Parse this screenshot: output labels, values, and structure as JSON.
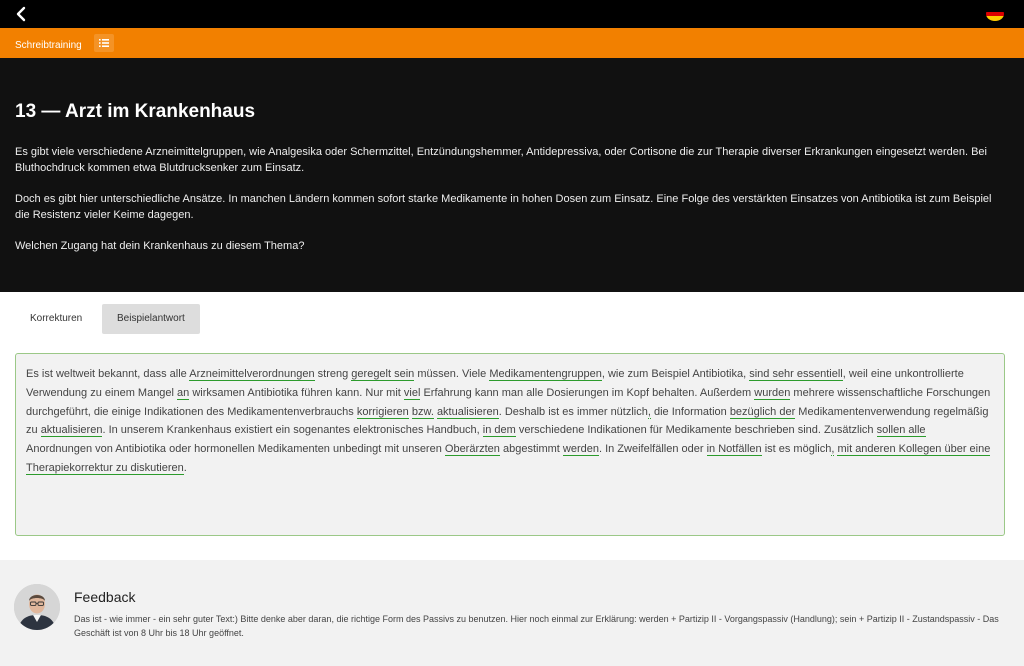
{
  "topbar": {
    "back_icon": "chevron-left-icon",
    "flag_icon": "german-flag-icon",
    "flag_colors": [
      "#000000",
      "#dd0000",
      "#ffcc00"
    ]
  },
  "header": {
    "section_title": "Schreibtraining",
    "list_icon": "list-icon"
  },
  "exercise": {
    "title": "13 — Arzt im Krankenhaus",
    "paragraphs": [
      "Es gibt viele verschiedene Arzneimittelgruppen, wie Analgesika oder Schermzittel, Entzündungshemmer, Antidepressiva, oder Cortisone die zur Therapie diverser Erkrankungen eingesetzt werden. Bei Bluthochdruck kommen etwa Blutdrucksenker zum Einsatz.",
      "Doch es gibt hier unterschiedliche Ansätze. In manchen Ländern kommen sofort starke Medikamente in hohen Dosen zum Einsatz. Eine Folge des verstärkten Einsatzes von Antibiotika ist zum Beispiel die Resistenz vieler Keime dagegen.",
      "Welchen Zugang hat dein Krankenhaus zu diesem Thema?"
    ]
  },
  "tabs": [
    {
      "label": "Korrekturen",
      "active": false
    },
    {
      "label": "Beispielantwort",
      "active": true
    }
  ],
  "answer": {
    "segments": [
      {
        "t": "Es ist weltweit bekannt, dass alle "
      },
      {
        "t": "Arzneimittelverordnungen",
        "mark": "u"
      },
      {
        "t": " streng "
      },
      {
        "t": "geregelt sein",
        "mark": "u"
      },
      {
        "t": " müssen. Viele "
      },
      {
        "t": "Medikamentengruppen",
        "mark": "u"
      },
      {
        "t": ", wie zum Beispiel Antibiotika, "
      },
      {
        "t": "sind sehr essentiell",
        "mark": "u"
      },
      {
        "t": ", weil eine unkontrollierte Verwendung zu einem Mangel "
      },
      {
        "t": "an",
        "mark": "u"
      },
      {
        "t": " wirksamen Antibiotika führen kann. Nur mit "
      },
      {
        "t": "viel",
        "mark": "u"
      },
      {
        "t": " Erfahrung kann man alle Dosierungen im Kopf behalten. Außerdem "
      },
      {
        "t": "wurden",
        "mark": "u"
      },
      {
        "t": " mehrere wissenschaftliche Forschungen durchgeführt, die einige Indikationen des Medikamentenverbrauchs "
      },
      {
        "t": "korrigieren",
        "mark": "u"
      },
      {
        "t": " "
      },
      {
        "t": "bzw.",
        "mark": "u"
      },
      {
        "t": " "
      },
      {
        "t": "aktualisieren",
        "mark": "u"
      },
      {
        "t": ". Deshalb ist es immer nützlich"
      },
      {
        "t": ",",
        "mark": "dot"
      },
      {
        "t": " die Information "
      },
      {
        "t": "bezüglich der",
        "mark": "u"
      },
      {
        "t": " Medikamentenverwendung regelmäßig zu "
      },
      {
        "t": "aktualisieren",
        "mark": "u"
      },
      {
        "t": ". In unserem Krankenhaus existiert ein sogenantes elektronisches Handbuch, "
      },
      {
        "t": "in dem",
        "mark": "u"
      },
      {
        "t": " verschiedene Indikationen für Medikamente beschrieben sind. Zusätzlich "
      },
      {
        "t": "sollen alle",
        "mark": "u"
      },
      {
        "t": " Anordnungen von Antibiotika oder hormonellen Medikamenten unbedingt mit unseren "
      },
      {
        "t": "Oberärzten",
        "mark": "u"
      },
      {
        "t": " abgestimmt "
      },
      {
        "t": "werden",
        "mark": "u"
      },
      {
        "t": ". In Zweifelfällen oder "
      },
      {
        "t": "in Notfällen",
        "mark": "u"
      },
      {
        "t": " ist es möglich"
      },
      {
        "t": ",",
        "mark": "dot"
      },
      {
        "t": " "
      },
      {
        "t": "mit anderen Kollegen über eine Therapiekorrektur zu diskutieren",
        "mark": "u"
      },
      {
        "t": "."
      }
    ]
  },
  "feedback": {
    "heading": "Feedback",
    "avatar_icon": "tutor-avatar-icon",
    "text": "Das ist - wie immer - ein sehr guter Text:) Bitte denke aber daran, die richtige Form des Passivs zu benutzen. Hier noch einmal zur Erklärung: werden + Partizip II - Vorgangspassiv (Handlung); sein + Partizip II - Zustandspassiv - Das Geschäft ist von 8 Uhr bis 18 Uhr geöffnet."
  },
  "colors": {
    "accent_orange": "#f28000",
    "correction_green": "#2c9b2c",
    "box_border": "#9bc887"
  }
}
